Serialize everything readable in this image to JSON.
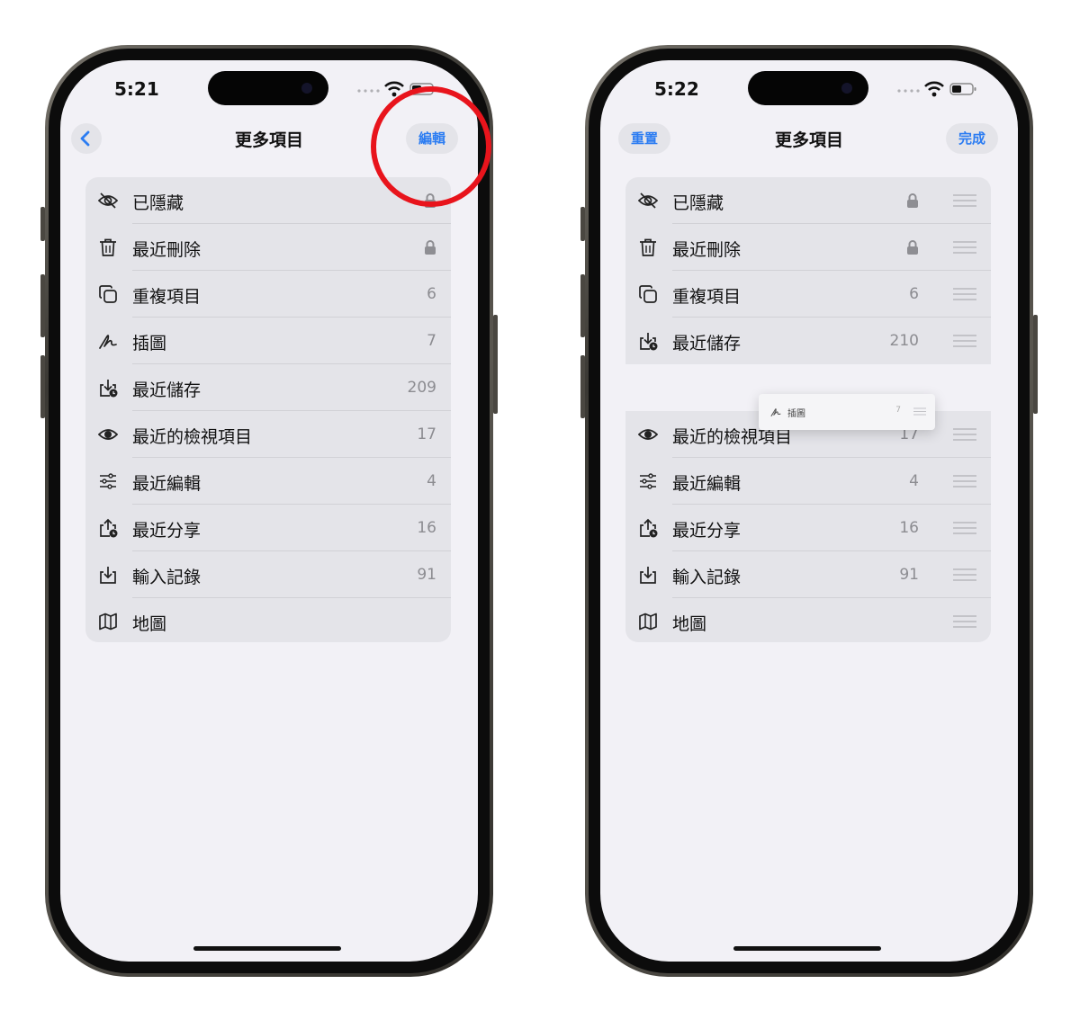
{
  "left_screen": {
    "time": "5:21",
    "nav_title": "更多項目",
    "edit_label": "編輯",
    "rows": [
      {
        "label": "已隱藏",
        "icon": "eye-slash-icon",
        "count": "",
        "locked": true
      },
      {
        "label": "最近刪除",
        "icon": "trash-icon",
        "count": "",
        "locked": true
      },
      {
        "label": "重複項目",
        "icon": "duplicate-icon",
        "count": "6",
        "locked": false
      },
      {
        "label": "插圖",
        "icon": "scribble-icon",
        "count": "7",
        "locked": false
      },
      {
        "label": "最近儲存",
        "icon": "tray-download-badge-icon",
        "count": "209",
        "locked": false
      },
      {
        "label": "最近的檢視項目",
        "icon": "eye-icon",
        "count": "17",
        "locked": false
      },
      {
        "label": "最近編輯",
        "icon": "sliders-icon",
        "count": "4",
        "locked": false
      },
      {
        "label": "最近分享",
        "icon": "share-badge-icon",
        "count": "16",
        "locked": false
      },
      {
        "label": "輸入記錄",
        "icon": "import-icon",
        "count": "91",
        "locked": false
      },
      {
        "label": "地圖",
        "icon": "map-icon",
        "count": "",
        "locked": false
      }
    ]
  },
  "right_screen": {
    "time": "5:22",
    "nav_title": "更多項目",
    "reset_label": "重置",
    "done_label": "完成",
    "rows": [
      {
        "label": "已隱藏",
        "icon": "eye-slash-icon",
        "count": "",
        "locked": true
      },
      {
        "label": "最近刪除",
        "icon": "trash-icon",
        "count": "",
        "locked": true
      },
      {
        "label": "重複項目",
        "icon": "duplicate-icon",
        "count": "6",
        "locked": false
      },
      {
        "label": "最近儲存",
        "icon": "tray-download-badge-icon",
        "count": "210",
        "locked": false
      },
      {
        "label": "最近的檢視項目",
        "icon": "eye-icon",
        "count": "17",
        "locked": false
      },
      {
        "label": "最近編輯",
        "icon": "sliders-icon",
        "count": "4",
        "locked": false
      },
      {
        "label": "最近分享",
        "icon": "share-badge-icon",
        "count": "16",
        "locked": false
      },
      {
        "label": "輸入記錄",
        "icon": "import-icon",
        "count": "91",
        "locked": false
      },
      {
        "label": "地圖",
        "icon": "map-icon",
        "count": "",
        "locked": false
      }
    ],
    "dragging_row": {
      "label": "插圖",
      "icon": "scribble-icon",
      "count": "7"
    }
  },
  "colors": {
    "accent": "#2b7cf2",
    "highlight_circle": "#e8141c",
    "screen_background": "#f2f1f6",
    "list_background": "#e4e4e9"
  }
}
